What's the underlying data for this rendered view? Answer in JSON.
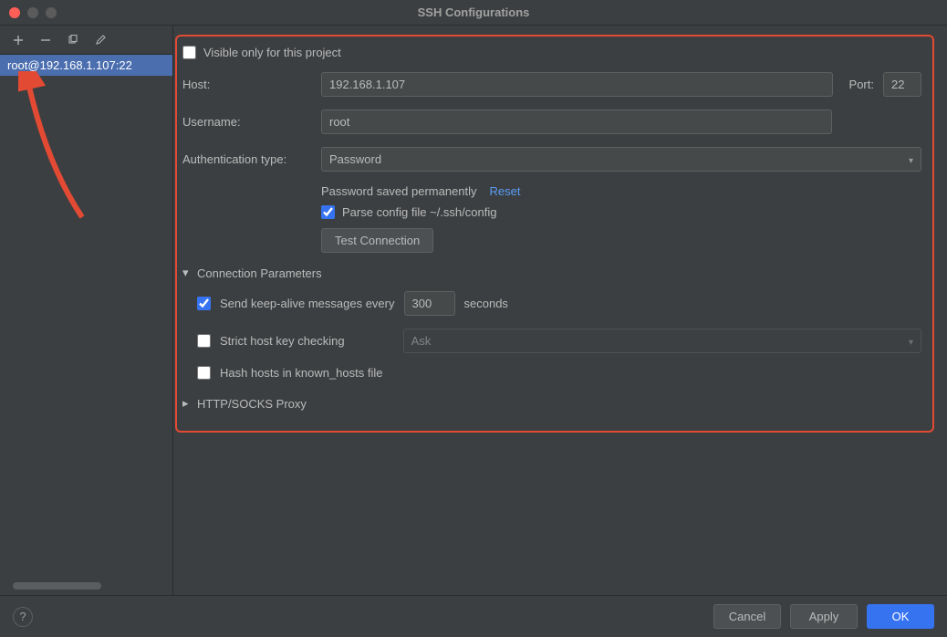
{
  "window": {
    "title": "SSH Configurations"
  },
  "sidebar": {
    "items": [
      {
        "label": "root@192.168.1.107:22"
      }
    ]
  },
  "form": {
    "visible_only_label": "Visible only for this project",
    "visible_only_checked": false,
    "host_label": "Host:",
    "host_value": "192.168.1.107",
    "port_label": "Port:",
    "port_value": "22",
    "username_label": "Username:",
    "username_value": "root",
    "auth_type_label": "Authentication type:",
    "auth_type_value": "Password",
    "password_saved_text": "Password saved permanently",
    "reset_link": "Reset",
    "parse_config_label": "Parse config file ~/.ssh/config",
    "parse_config_checked": true,
    "test_connection_label": "Test Connection",
    "connection_params": {
      "title": "Connection Parameters",
      "expanded": true,
      "keepalive_checked": true,
      "keepalive_prefix": "Send keep-alive messages every",
      "keepalive_value": "300",
      "keepalive_suffix": "seconds",
      "strict_label": "Strict host key checking",
      "strict_checked": false,
      "strict_select_value": "Ask",
      "hash_label": "Hash hosts in known_hosts file",
      "hash_checked": false
    },
    "proxy": {
      "title": "HTTP/SOCKS Proxy",
      "expanded": false
    }
  },
  "footer": {
    "cancel": "Cancel",
    "apply": "Apply",
    "ok": "OK"
  }
}
